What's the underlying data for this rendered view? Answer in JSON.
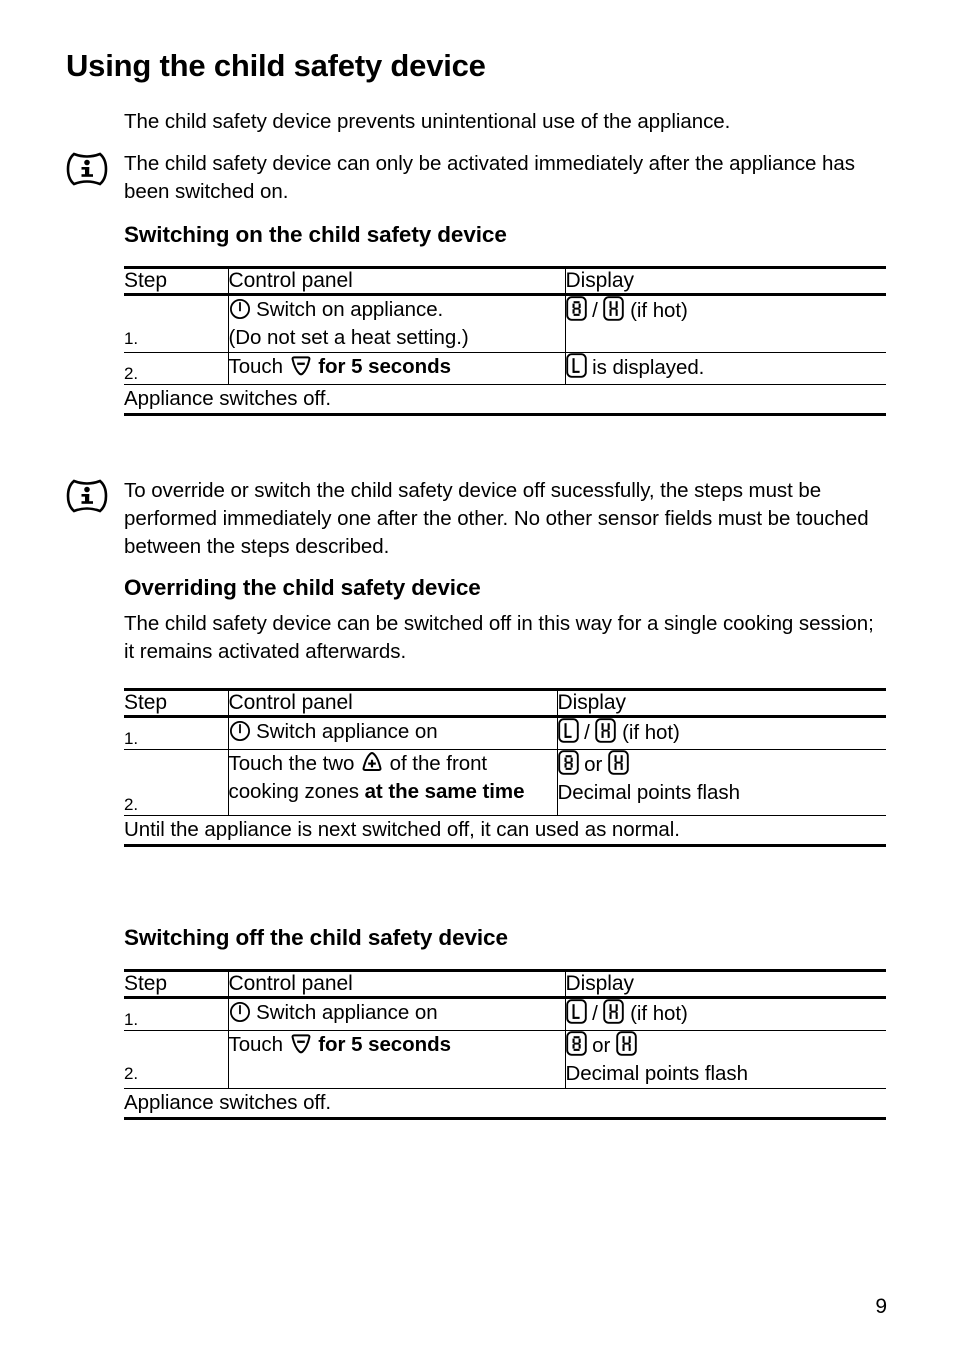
{
  "page": {
    "title": "Using the child safety device",
    "page_number": "9",
    "intro": "The child safety device prevents unintentional use of the appliance."
  },
  "notes": [
    {
      "icon": "info-icon",
      "text": "The child safety device can only be activated immediately after the appliance has been switched on."
    },
    {
      "icon": "info-icon",
      "text": "To override or switch the child safety device off sucessfully, the steps must be performed immediately one after the other. No other sensor fields must be touched between the steps described."
    }
  ],
  "sections": [
    {
      "heading": "Switching on the child safety device",
      "table": {
        "headers": [
          "Step",
          "Control panel",
          "Display"
        ],
        "rows": [
          {
            "step": "1.",
            "control_panel_pre": "",
            "control_panel_icon": "power-icon",
            "control_panel_line1": "Switch on appliance.",
            "control_panel_line2": "(Do not set a heat setting.)",
            "display_line1_a": "display-0",
            "display_sep": "/",
            "display_line1_b": "display-H",
            "display_line1_tail": "(if hot)",
            "display_line2": ""
          },
          {
            "step": "2.",
            "control_panel_pre": "Touch",
            "control_panel_icon": "minus-triangle-icon",
            "control_panel_bold": "for 5 seconds",
            "display_line1_a": "display-L",
            "display_line1_tail": "is displayed.",
            "display_line2": ""
          }
        ],
        "footer": "Appliance switches off."
      }
    },
    {
      "heading": "Overriding the child safety device",
      "intro": "The child safety device can be switched off in this way for a single cooking session; it remains activated afterwards.",
      "table": {
        "headers": [
          "Step",
          "Control panel",
          "Display"
        ],
        "rows": [
          {
            "step": "1.",
            "control_panel_icon": "power-icon",
            "control_panel_line1": "Switch appliance on",
            "display_line1_a": "display-L",
            "display_sep": "/",
            "display_line1_b": "display-H",
            "display_line1_tail": "(if hot)",
            "display_line2": ""
          },
          {
            "step": "2.",
            "control_panel_pre": "Touch the two",
            "control_panel_icon": "plus-triangle-icon",
            "control_panel_mid": "of the front cooking zones",
            "control_panel_bold": "at the same time",
            "display_line1_a": "display-0",
            "display_sep": "or",
            "display_line1_b": "display-H",
            "display_line1_tail": "",
            "display_line2": "Decimal points flash"
          }
        ],
        "footer": "Until the appliance is next switched off, it can used as normal."
      }
    },
    {
      "heading": "Switching off the child safety device",
      "table": {
        "headers": [
          "Step",
          "Control panel",
          "Display"
        ],
        "rows": [
          {
            "step": "1.",
            "control_panel_icon": "power-icon",
            "control_panel_line1": "Switch appliance on",
            "display_line1_a": "display-L",
            "display_sep": "/",
            "display_line1_b": "display-H",
            "display_line1_tail": "(if hot)",
            "display_line2": ""
          },
          {
            "step": "2.",
            "control_panel_pre": "Touch",
            "control_panel_icon": "minus-triangle-icon",
            "control_panel_bold": "for 5 seconds",
            "display_line1_a": "display-0",
            "display_sep": "or",
            "display_line1_b": "display-H",
            "display_line1_tail": "",
            "display_line2": "Decimal points flash"
          }
        ],
        "footer": "Appliance switches off."
      }
    }
  ],
  "glyph_labels": {
    "display_0": "0",
    "display_H": "H",
    "display_L": "L",
    "power": "power on/off",
    "plus": "+",
    "minus": "-"
  },
  "colors": {
    "ink": "#000000",
    "paper": "#ffffff"
  }
}
